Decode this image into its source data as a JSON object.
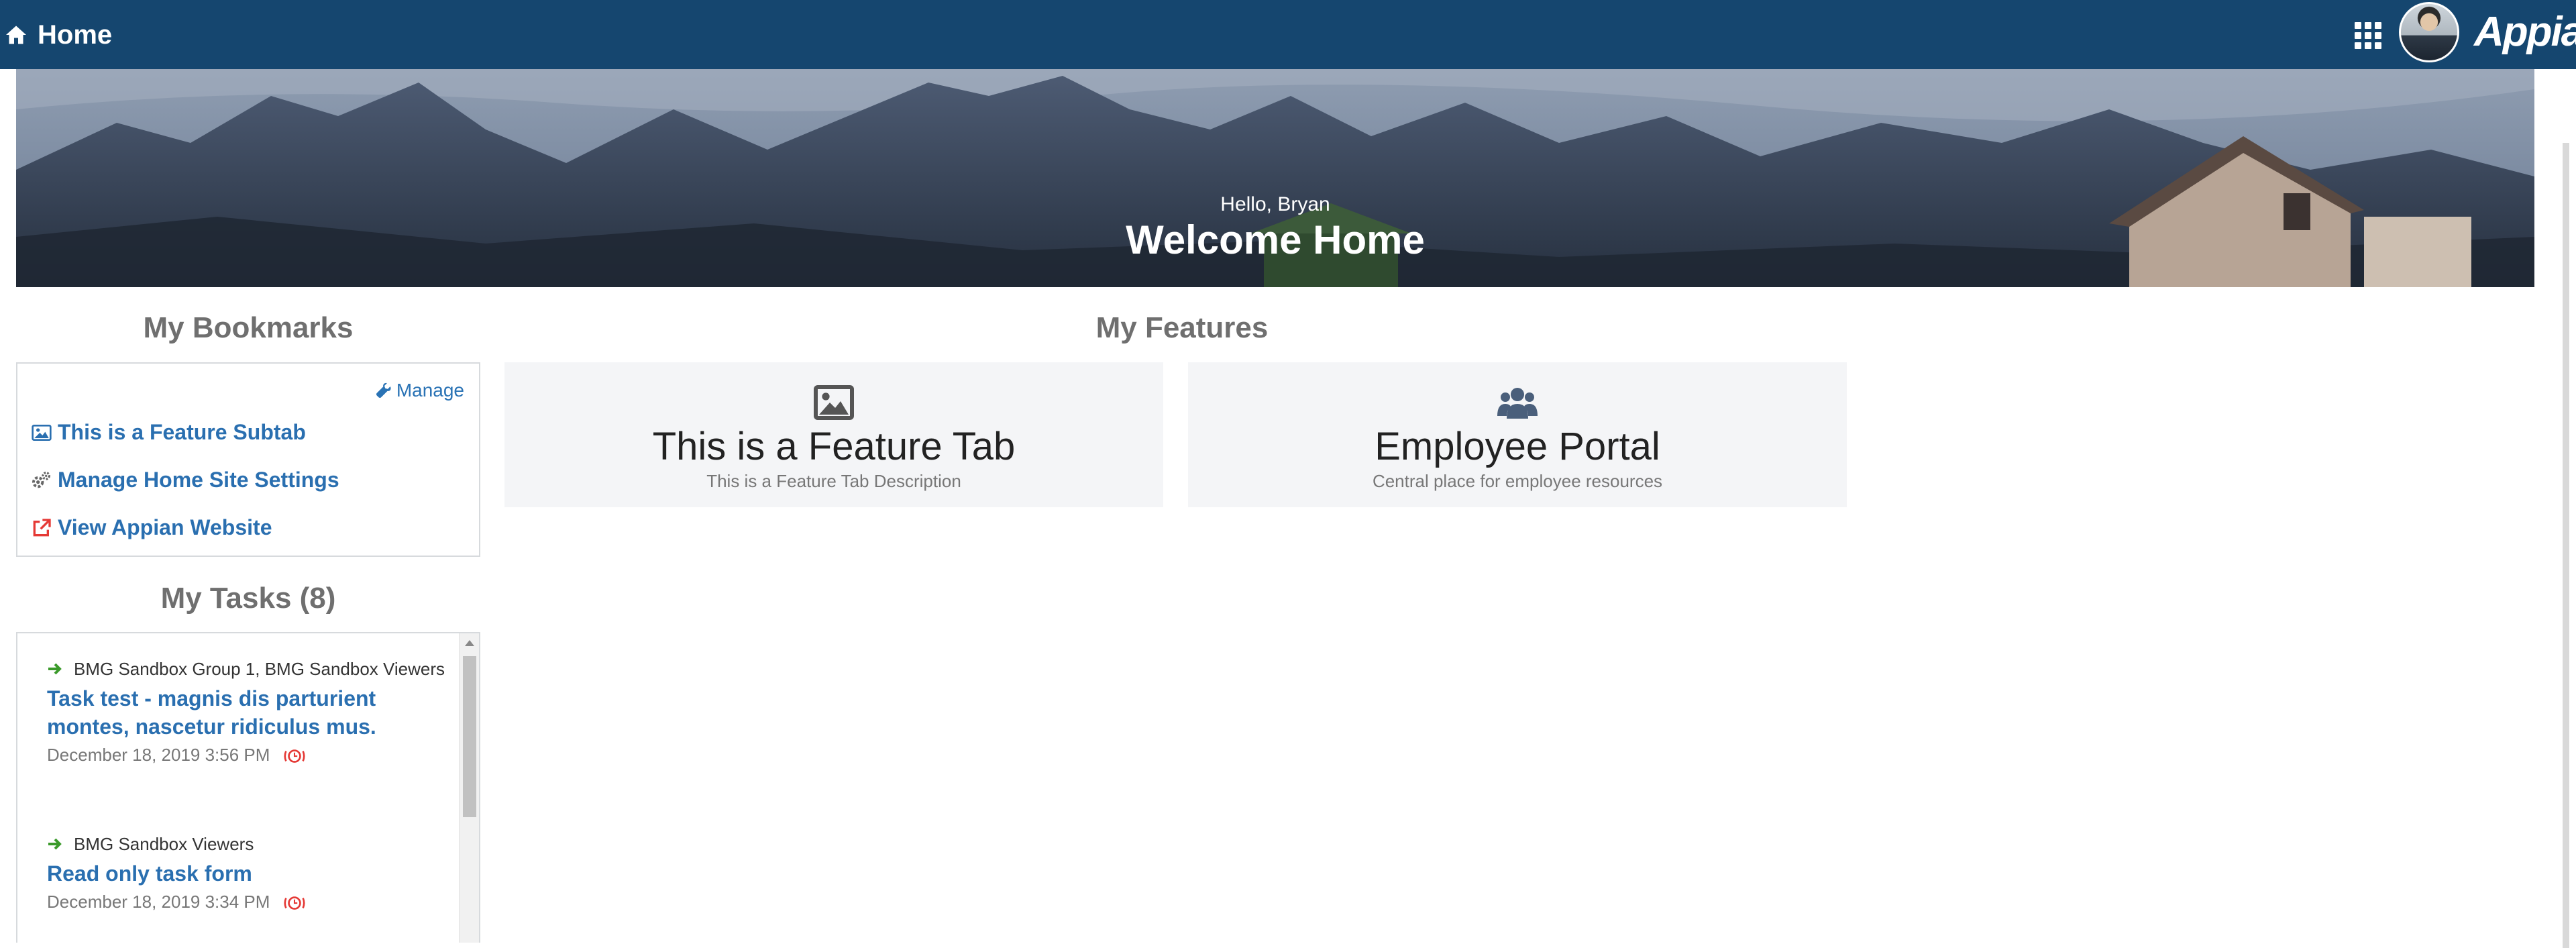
{
  "topbar": {
    "home_label": "Home",
    "brand": "Appian",
    "background_color": "#15466f"
  },
  "banner": {
    "greeting": "Hello, Bryan",
    "title": "Welcome Home"
  },
  "bookmarks": {
    "heading": "My Bookmarks",
    "manage_label": "Manage",
    "items": [
      {
        "label": "This is a Feature Subtab",
        "icon": "image-icon"
      },
      {
        "label": "Manage Home Site Settings",
        "icon": "gears-icon"
      },
      {
        "label": "View Appian Website",
        "icon": "external-link-icon"
      }
    ]
  },
  "tasks": {
    "heading": "My Tasks (8)",
    "items": [
      {
        "group": "BMG Sandbox Group 1, BMG Sandbox Viewers",
        "title": "Task test - magnis dis parturient montes, nascetur ridiculus mus.",
        "date": "December 18, 2019 3:56 PM"
      },
      {
        "group": "BMG Sandbox Viewers",
        "title": "Read only task form",
        "date": "December 18, 2019 3:34 PM"
      }
    ]
  },
  "features": {
    "heading": "My Features",
    "items": [
      {
        "title": "This is a Feature Tab",
        "description": "This is a Feature Tab Description",
        "icon": "image-icon"
      },
      {
        "title": "Employee Portal",
        "description": "Central place for employee resources",
        "icon": "users-icon"
      }
    ]
  },
  "colors": {
    "link": "#2a6fb0",
    "heading": "#6f6f6f",
    "tile_bg": "#f4f5f7",
    "task_arrow": "#3a9a2a",
    "alarm": "#e53935"
  }
}
